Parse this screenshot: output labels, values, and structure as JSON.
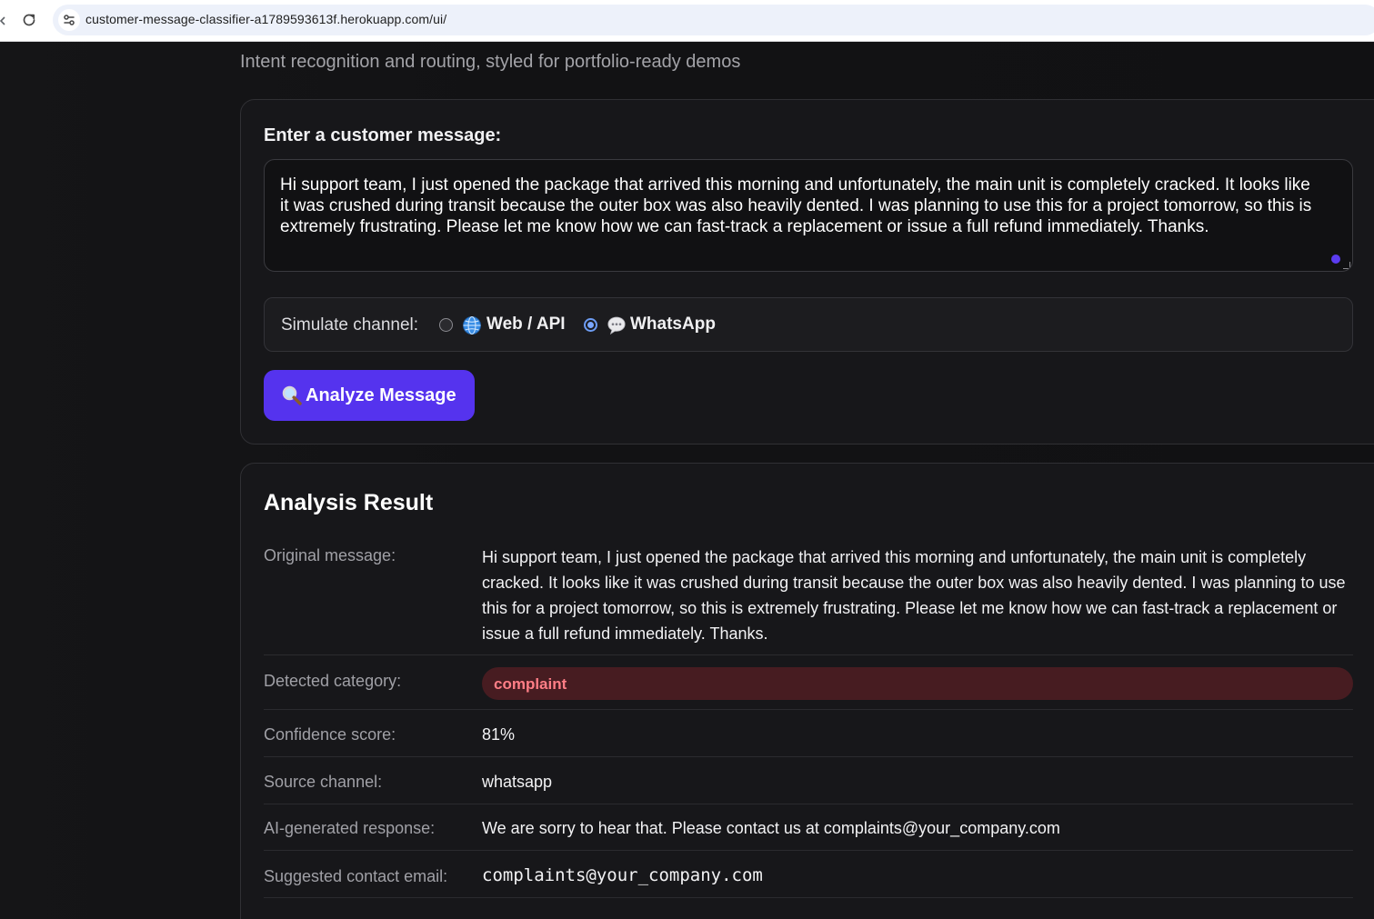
{
  "browser": {
    "url": "customer-message-classifier-a1789593613f.herokuapp.com/ui/"
  },
  "page": {
    "subtitle": "Intent recognition and routing, styled for portfolio-ready demos"
  },
  "form": {
    "message_label": "Enter a customer message:",
    "message_value": "Hi support team, I just opened the package that arrived this morning and unfortunately, the main unit is completely cracked. It looks like it was crushed during transit because the outer box was also heavily dented. I was planning to use this for a project tomorrow, so this is extremely frustrating. Please let me know how we can fast-track a replacement or issue a full refund immediately. Thanks.",
    "channel_label": "Simulate channel:",
    "channel_options": [
      {
        "label": "Web / API",
        "icon": "globe-icon",
        "selected": false
      },
      {
        "label": "WhatsApp",
        "icon": "speech-bubble-icon",
        "selected": true
      }
    ],
    "analyze_label": "Analyze Message",
    "analyze_icon": "magnifier-icon"
  },
  "result": {
    "title": "Analysis Result",
    "original_label": "Original message:",
    "original_value": "Hi support team, I just opened the package that arrived this morning and unfortunately, the main unit is completely cracked. It looks like it was crushed during transit because the outer box was also heavily dented. I was planning to use this for a project tomorrow, so this is extremely frustrating. Please let me know how we can fast-track a replacement or issue a full refund immediately. Thanks.",
    "category_label": "Detected category:",
    "category_value": "complaint",
    "confidence_label": "Confidence score:",
    "confidence_value": "81%",
    "source_label": "Source channel:",
    "source_value": "whatsapp",
    "response_label": "AI-generated response:",
    "response_value": "We are sorry to hear that. Please contact us at complaints@your_company.com",
    "email_label": "Suggested contact email:",
    "email_value": "complaints@your_company.com"
  },
  "colors": {
    "accent": "#5533ee",
    "complaint_bg": "#471c21",
    "complaint_text": "#ff7e86",
    "radio_selected": "#7aa7ff"
  }
}
